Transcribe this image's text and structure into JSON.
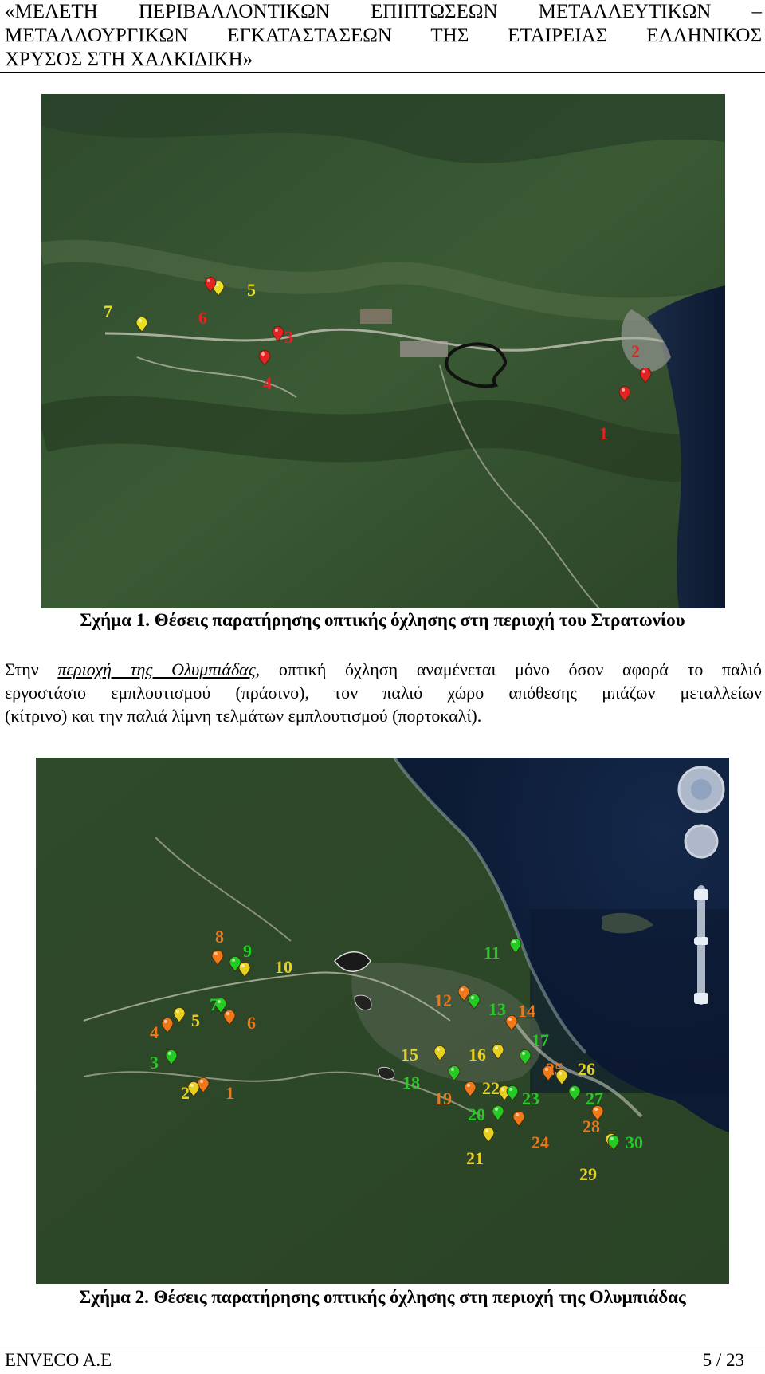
{
  "header": {
    "line1": "«ΜΕΛΕΤΗ ΠΕΡΙΒΑΛΛΟΝΤΙΚΩΝ ΕΠΙΠΤΩΣΕΩΝ ΜΕΤΑΛΛΕΥΤΙΚΩΝ –",
    "line2": "ΜΕΤΑΛΛΟΥΡΓΙΚΩΝ ΕΓΚΑΤΑΣΤΑΣΕΩΝ ΤΗΣ ΕΤΑΙΡΕΙΑΣ ΕΛΛΗΝΙΚΟΣ",
    "line3": "ΧΡΥΣΟΣ ΣΤΗ ΧΑΛΚΙΔΙΚΗ»"
  },
  "figure1": {
    "caption": "Σχήμα 1. Θέσεις παρατήρησης οπτικής όχλησης στη περιοχή του Στρατωνίου",
    "markers": [
      {
        "label": "1",
        "color": "#e32222"
      },
      {
        "label": "2",
        "color": "#e32222"
      },
      {
        "label": "3",
        "color": "#e32222"
      },
      {
        "label": "4",
        "color": "#e32222"
      },
      {
        "label": "5",
        "color": "#e8e020"
      },
      {
        "label": "6",
        "color": "#e32222"
      },
      {
        "label": "7",
        "color": "#e8e020"
      }
    ]
  },
  "paragraph": {
    "link": "περιοχή της Ολυμπιάδας",
    "line1_prefix": "Στην ",
    "line1_suffix": ", οπτική όχληση αναμένεται μόνο όσον αφορά το παλιό",
    "line2": "εργοστάσιο εμπλουτισμού (πράσινο), τον παλιό χώρο απόθεσης μπάζων μεταλλείων",
    "line3": "(κίτρινο) και την παλιά λίμνη τελμάτων εμπλουτισμού (πορτοκαλί)."
  },
  "figure2": {
    "caption": "Σχήμα 2. Θέσεις παρατήρησης οπτικής όχλησης στη περιοχή της Ολυμπιάδας",
    "markers": [
      {
        "label": "1",
        "color": "#f07818"
      },
      {
        "label": "2",
        "color": "#e8d020"
      },
      {
        "label": "3",
        "color": "#22cc22"
      },
      {
        "label": "4",
        "color": "#f07818"
      },
      {
        "label": "5",
        "color": "#e8d020"
      },
      {
        "label": "6",
        "color": "#f07818"
      },
      {
        "label": "7",
        "color": "#22cc22"
      },
      {
        "label": "8",
        "color": "#f07818"
      },
      {
        "label": "9",
        "color": "#22cc22"
      },
      {
        "label": "10",
        "color": "#e8d020"
      },
      {
        "label": "11",
        "color": "#22cc22"
      },
      {
        "label": "12",
        "color": "#f07818"
      },
      {
        "label": "13",
        "color": "#22cc22"
      },
      {
        "label": "14",
        "color": "#f07818"
      },
      {
        "label": "15",
        "color": "#e8d020"
      },
      {
        "label": "16",
        "color": "#e8d020"
      },
      {
        "label": "17",
        "color": "#22cc22"
      },
      {
        "label": "18",
        "color": "#22cc22"
      },
      {
        "label": "19",
        "color": "#f07818"
      },
      {
        "label": "20",
        "color": "#22cc22"
      },
      {
        "label": "21",
        "color": "#e8d020"
      },
      {
        "label": "22",
        "color": "#e8d020"
      },
      {
        "label": "23",
        "color": "#22cc22"
      },
      {
        "label": "24",
        "color": "#f07818"
      },
      {
        "label": "25",
        "color": "#f07818"
      },
      {
        "label": "26",
        "color": "#e8d020"
      },
      {
        "label": "27",
        "color": "#22cc22"
      },
      {
        "label": "28",
        "color": "#f07818"
      },
      {
        "label": "29",
        "color": "#e8d020"
      },
      {
        "label": "30",
        "color": "#22cc22"
      }
    ]
  },
  "footer": {
    "company": "ENVECO A.E",
    "page": "5 / 23"
  }
}
